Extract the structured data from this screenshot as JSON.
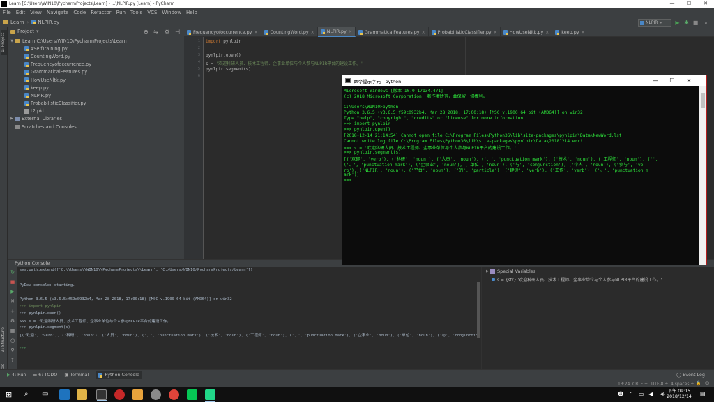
{
  "window": {
    "title": "Learn [C:\\Users\\WIN10\\PycharmProjects\\Learn] - ...\\NLPIR.py [Learn] - PyCharm",
    "minimize": "—",
    "maximize": "☐",
    "close": "✕"
  },
  "menu": [
    "File",
    "Edit",
    "View",
    "Navigate",
    "Code",
    "Refactor",
    "Run",
    "Tools",
    "VCS",
    "Window",
    "Help"
  ],
  "nav": {
    "project": "Learn",
    "file": "NLPIR.py",
    "run_config": "NLPIR"
  },
  "side_tabs": {
    "project": "1: Project",
    "structure": "Z: Structure",
    "favorites": "2: Favorites"
  },
  "project_panel": {
    "header": "Project",
    "root": "Learn  C:\\Users\\WIN10\\PycharmProjects\\Learn",
    "files": [
      "4SelfTraining.py",
      "CountingWord.py",
      "Frequencyofoccurrence.py",
      "GrammaticalFeatures.py",
      "HowUseNltk.py",
      "keep.py",
      "NLPIR.py",
      "ProbabilisticClassifier.py",
      "t2.pkl"
    ],
    "external": "External Libraries",
    "scratches": "Scratches and Consoles"
  },
  "editor_tabs": [
    {
      "label": "Frequencyofoccurrence.py",
      "active": false
    },
    {
      "label": "CountingWord.py",
      "active": false
    },
    {
      "label": "NLPIR.py",
      "active": true
    },
    {
      "label": "GrammaticalFeatures.py",
      "active": false
    },
    {
      "label": "ProbabilisticClassifier.py",
      "active": false
    },
    {
      "label": "HowUseNltk.py",
      "active": false
    },
    {
      "label": "keep.py",
      "active": false
    }
  ],
  "code": {
    "line_numbers": [
      "1",
      "2",
      "3",
      "4",
      "5",
      "6"
    ],
    "l1_kw": "import",
    "l1_rest": " pynlpir",
    "l3": "pynlpir.open()",
    "l4_pre": "s = ",
    "l4_str": "'欢迎科研人员、技术工程师、企事业单位与个人参与NLPIR平台的建设工作。'",
    "l5": "pynlpir.segment(s)"
  },
  "console": {
    "header": "Python Console",
    "lines": [
      "sys.path.extend(['C:\\\\Users\\\\WIN10\\\\PycharmProjects\\\\Learn', 'C:/Users/WIN10/PycharmProjects/Learn'])",
      "PyDev console: starting.",
      "Python 3.6.5 (v3.6.5:f59c0932b4, Mar 28 2018, 17:00:18) [MSC v.1900 64 bit (AMD64)] on win32",
      ">>> import pynlpir",
      ">>> pynlpir.open()",
      ">>> s = '欢迎科研人员、技术工程师、企事业单位与个人参与NLPIR平台的建设工作。'",
      ">>> pynlpir.segment(s)",
      "[('欢迎', 'verb'), ('科研', 'noun'), ('人员', 'noun'), ('、', 'punctuation mark'), ('技术', 'noun'), ('工程师', 'noun'), ('、', 'punctuation mark'), ('企事业', 'noun'), ('单位', 'noun'), ('与', 'conjunction'",
      ">>>"
    ]
  },
  "special_vars": {
    "header": "Special Variables",
    "s_row": "s = {str} '欢迎科研人员、技术工程师、企事业单位与个人参与NLPIR平台的建设工作。'"
  },
  "bottom_tabs": [
    "4: Run",
    "6: TODO",
    "Terminal",
    "Python Console"
  ],
  "event_log": "Event Log",
  "status": {
    "pos": "13:24",
    "crlf": "CRLF ÷",
    "enc": "UTF-8 ÷",
    "spaces": "4 spaces ÷"
  },
  "cmd": {
    "title": "命令提示字元 - python",
    "lines": [
      "Microsoft Windows [版本 10.0.17134.471]",
      "(c) 2018 Microsoft Corporation. 著作權所有，並保留一切權利。",
      "",
      "C:\\Users\\WIN10>python",
      "Python 3.6.5 (v3.6.5:f59c0932b4, Mar 28 2018, 17:00:18) [MSC v.1900 64 bit (AMD64)] on win32",
      "Type \"help\", \"copyright\", \"credits\" or \"license\" for more information.",
      ">>> import pynlpir",
      ">>> pynlpir.open()",
      "[2018-12-14 21:14:54] Cannot open file C:\\Program Files\\Python36\\lib\\site-packages\\pynlpir\\Data\\NewWord.lst",
      "Cannot write log file C:\\Program Files\\Python36\\lib\\site-packages\\pynlpir\\Data\\20181214.err!",
      ">>> s = '欢迎科研人员、技术工程师、企事业单位与个人参与NLPIR平台的建设工作。'",
      ">>> pynlpir.segment(s)",
      "[('欢迎', 'verb'), ('科研', 'noun'), ('人员', 'noun'), ('、', 'punctuation mark'), ('技术', 'noun'), ('工程师', 'noun'), ('',",
      "('、', 'punctuation mark'), ('企事业', 'noun'), ('单位', 'noun'), ('与', 'conjunction'), ('个人', 'noun'), ('参与', 've",
      "rb'), ('NLPIR', 'noun'), ('平台', 'noun'), ('的', 'particle'), ('建设', 'verb'), ('工作', 'verb'), ('。', 'punctuation m",
      "ark')]",
      ">>>"
    ]
  },
  "taskbar": {
    "time": "下午 09:15",
    "date": "2018/12/14",
    "ime": "英"
  }
}
